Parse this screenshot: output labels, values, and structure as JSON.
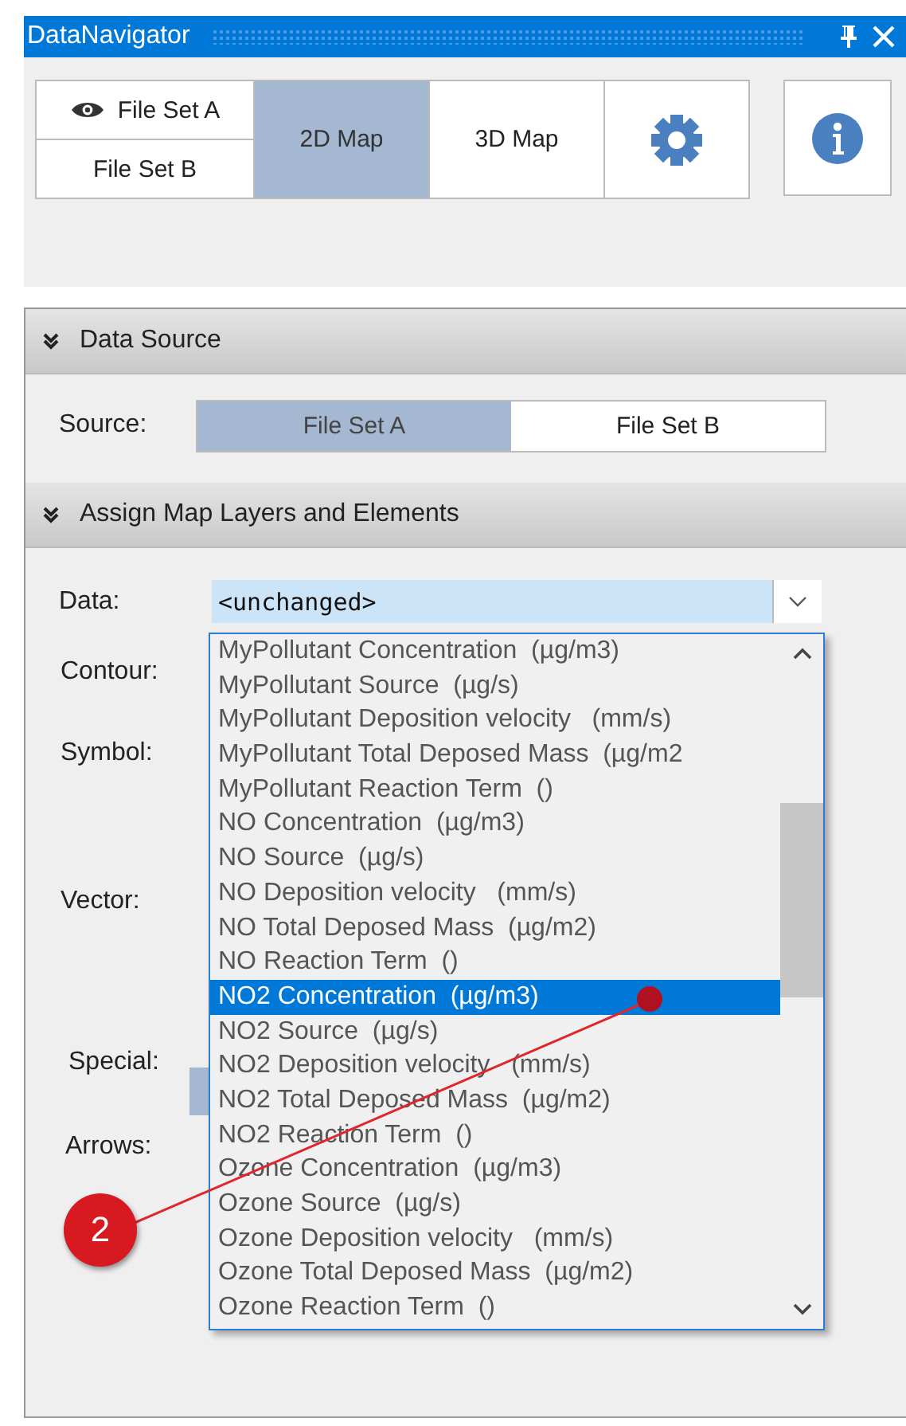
{
  "window": {
    "title": "DataNavigator"
  },
  "toolbar": {
    "file_sets": [
      {
        "label": "File Set A",
        "visible": true
      },
      {
        "label": "File Set B",
        "visible": false
      }
    ],
    "view_tabs": [
      {
        "label": "2D Map",
        "selected": true
      },
      {
        "label": "3D Map",
        "selected": false
      }
    ]
  },
  "data_source": {
    "title": "Data Source",
    "source_label": "Source:",
    "options": [
      {
        "label": "File Set A",
        "selected": true
      },
      {
        "label": "File Set B",
        "selected": false
      }
    ]
  },
  "assign": {
    "title": "Assign Map Layers and Elements",
    "data_label": "Data:",
    "data_value": "<unchanged>",
    "labels": [
      {
        "text": "Contour:"
      },
      {
        "text": "Symbol:"
      },
      {
        "text": "Vector:"
      },
      {
        "text": "Special:"
      },
      {
        "text": "Arrows:"
      }
    ],
    "dropdown_items": [
      {
        "text": "MyPollutant Concentration  (µg/m3)",
        "selected": false
      },
      {
        "text": "MyPollutant Source  (µg/s)",
        "selected": false
      },
      {
        "text": "MyPollutant Deposition velocity   (mm/s)",
        "selected": false
      },
      {
        "text": "MyPollutant Total Deposed Mass  (µg/m2",
        "selected": false
      },
      {
        "text": "MyPollutant Reaction Term  ()",
        "selected": false
      },
      {
        "text": "NO Concentration  (µg/m3)",
        "selected": false
      },
      {
        "text": "NO Source  (µg/s)",
        "selected": false
      },
      {
        "text": "NO Deposition velocity   (mm/s)",
        "selected": false
      },
      {
        "text": "NO Total Deposed Mass  (µg/m2)",
        "selected": false
      },
      {
        "text": "NO Reaction Term  ()",
        "selected": false
      },
      {
        "text": "NO2 Concentration  (µg/m3)",
        "selected": true
      },
      {
        "text": "NO2 Source  (µg/s)",
        "selected": false
      },
      {
        "text": "NO2 Deposition velocity   (mm/s)",
        "selected": false
      },
      {
        "text": "NO2 Total Deposed Mass  (µg/m2)",
        "selected": false
      },
      {
        "text": "NO2 Reaction Term  ()",
        "selected": false
      },
      {
        "text": "Ozone Concentration  (µg/m3)",
        "selected": false
      },
      {
        "text": "Ozone Source  (µg/s)",
        "selected": false
      },
      {
        "text": "Ozone Deposition velocity   (mm/s)",
        "selected": false
      },
      {
        "text": "Ozone Total Deposed Mass  (µg/m2)",
        "selected": false
      },
      {
        "text": "Ozone Reaction Term  ()",
        "selected": false
      }
    ]
  },
  "callout": {
    "number": "2"
  }
}
